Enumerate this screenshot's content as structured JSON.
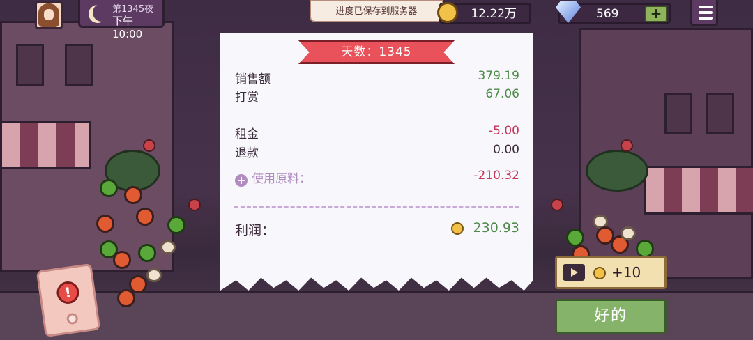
{
  "top_bar": {
    "day_label": "第1345夜",
    "time_label": "下午10:00",
    "toast": "进度已保存到服务器",
    "gold": "12.22万",
    "gems": "569",
    "gems_plus": "+"
  },
  "receipt": {
    "title": "天数：1345",
    "sales_label": "销售额",
    "sales_value": "379.19",
    "tips_label": "打赏",
    "tips_value": "67.06",
    "rent_label": "租金",
    "rent_value": "-5.00",
    "refund_label": "退款",
    "refund_value": "0.00",
    "ingredients_label": "使用原料：",
    "ingredients_value": "-210.32",
    "profit_label": "利润：",
    "profit_value": "230.93"
  },
  "actions": {
    "ad_reward": "+10",
    "ok_label": "好的",
    "alert_mark": "!"
  },
  "colors": {
    "positive": "#4e8a4a",
    "negative": "#c2385a",
    "banner": "#e9525a",
    "ok_button": "#86b36a"
  },
  "icons": [
    "avatar",
    "moon-icon",
    "gold-coin-icon",
    "diamond-icon",
    "plus-icon",
    "menu-icon",
    "plus-circle-icon",
    "coin-icon",
    "play-icon",
    "alert-icon"
  ]
}
